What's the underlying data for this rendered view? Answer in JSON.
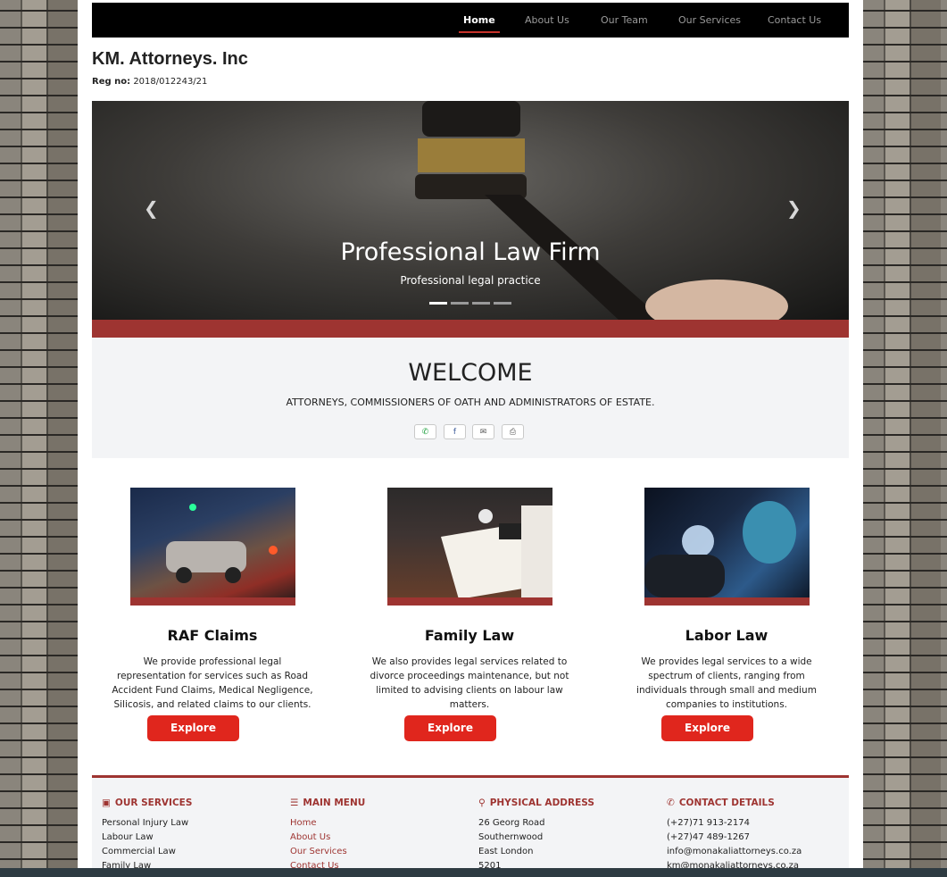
{
  "nav": {
    "items": [
      {
        "label": "Home",
        "active": true
      },
      {
        "label": "About Us",
        "active": false
      },
      {
        "label": "Our Team",
        "active": false
      },
      {
        "label": "Our Services",
        "active": false
      },
      {
        "label": "Contact Us",
        "active": false
      }
    ]
  },
  "brand": {
    "name": "KM. Attorneys. Inc",
    "reg_label": "Reg no:",
    "reg_value": "2018/012243/21"
  },
  "hero": {
    "title": "Professional Law Firm",
    "subtitle": "Professional legal practice",
    "prev_icon": "chevron-left-icon",
    "next_icon": "chevron-right-icon",
    "slides_count": 4,
    "active_slide": 1
  },
  "welcome": {
    "title": "WELCOME",
    "subtitle": "ATTORNEYS, COMMISSIONERS OF OATH AND ADMINISTRATORS OF ESTATE.",
    "share_icons": [
      "whatsapp-icon",
      "facebook-icon",
      "email-icon",
      "print-icon"
    ]
  },
  "cards": [
    {
      "title": "RAF Claims",
      "text": "We provide professional legal representation for services such as Road Accident Fund Claims, Medical Negligence, Silicosis, and related claims to our clients.",
      "button": "Explore"
    },
    {
      "title": "Family Law",
      "text": "We also provides legal services related to divorce proceedings maintenance, but not limited to advising clients on labour law matters.",
      "button": "Explore"
    },
    {
      "title": "Labor Law",
      "text": "We provides legal services to a wide spectrum of clients, ranging from individuals through small and medium companies to institutions.",
      "button": "Explore"
    }
  ],
  "footer": {
    "services": {
      "heading": "OUR SERVICES",
      "items": [
        "Personal Injury Law",
        "Labour Law",
        "Commercial Law",
        "Family Law"
      ]
    },
    "menu": {
      "heading": "MAIN MENU",
      "items": [
        "Home",
        "About Us",
        "Our Services",
        "Contact Us"
      ]
    },
    "address": {
      "heading": "PHYSICAL ADDRESS",
      "items": [
        "26 Georg Road",
        "Southernwood",
        "East London",
        "5201"
      ]
    },
    "contact": {
      "heading": "CONTACT DETAILS",
      "items": [
        "(+27)71 913-2174",
        "(+27)47 489-1267",
        "info@monakaliattorneys.co.za",
        "km@monakaliattorneys.co.za"
      ]
    }
  },
  "colors": {
    "accent": "#9e3431",
    "button": "#e0261d",
    "nav_bg": "#000000"
  }
}
